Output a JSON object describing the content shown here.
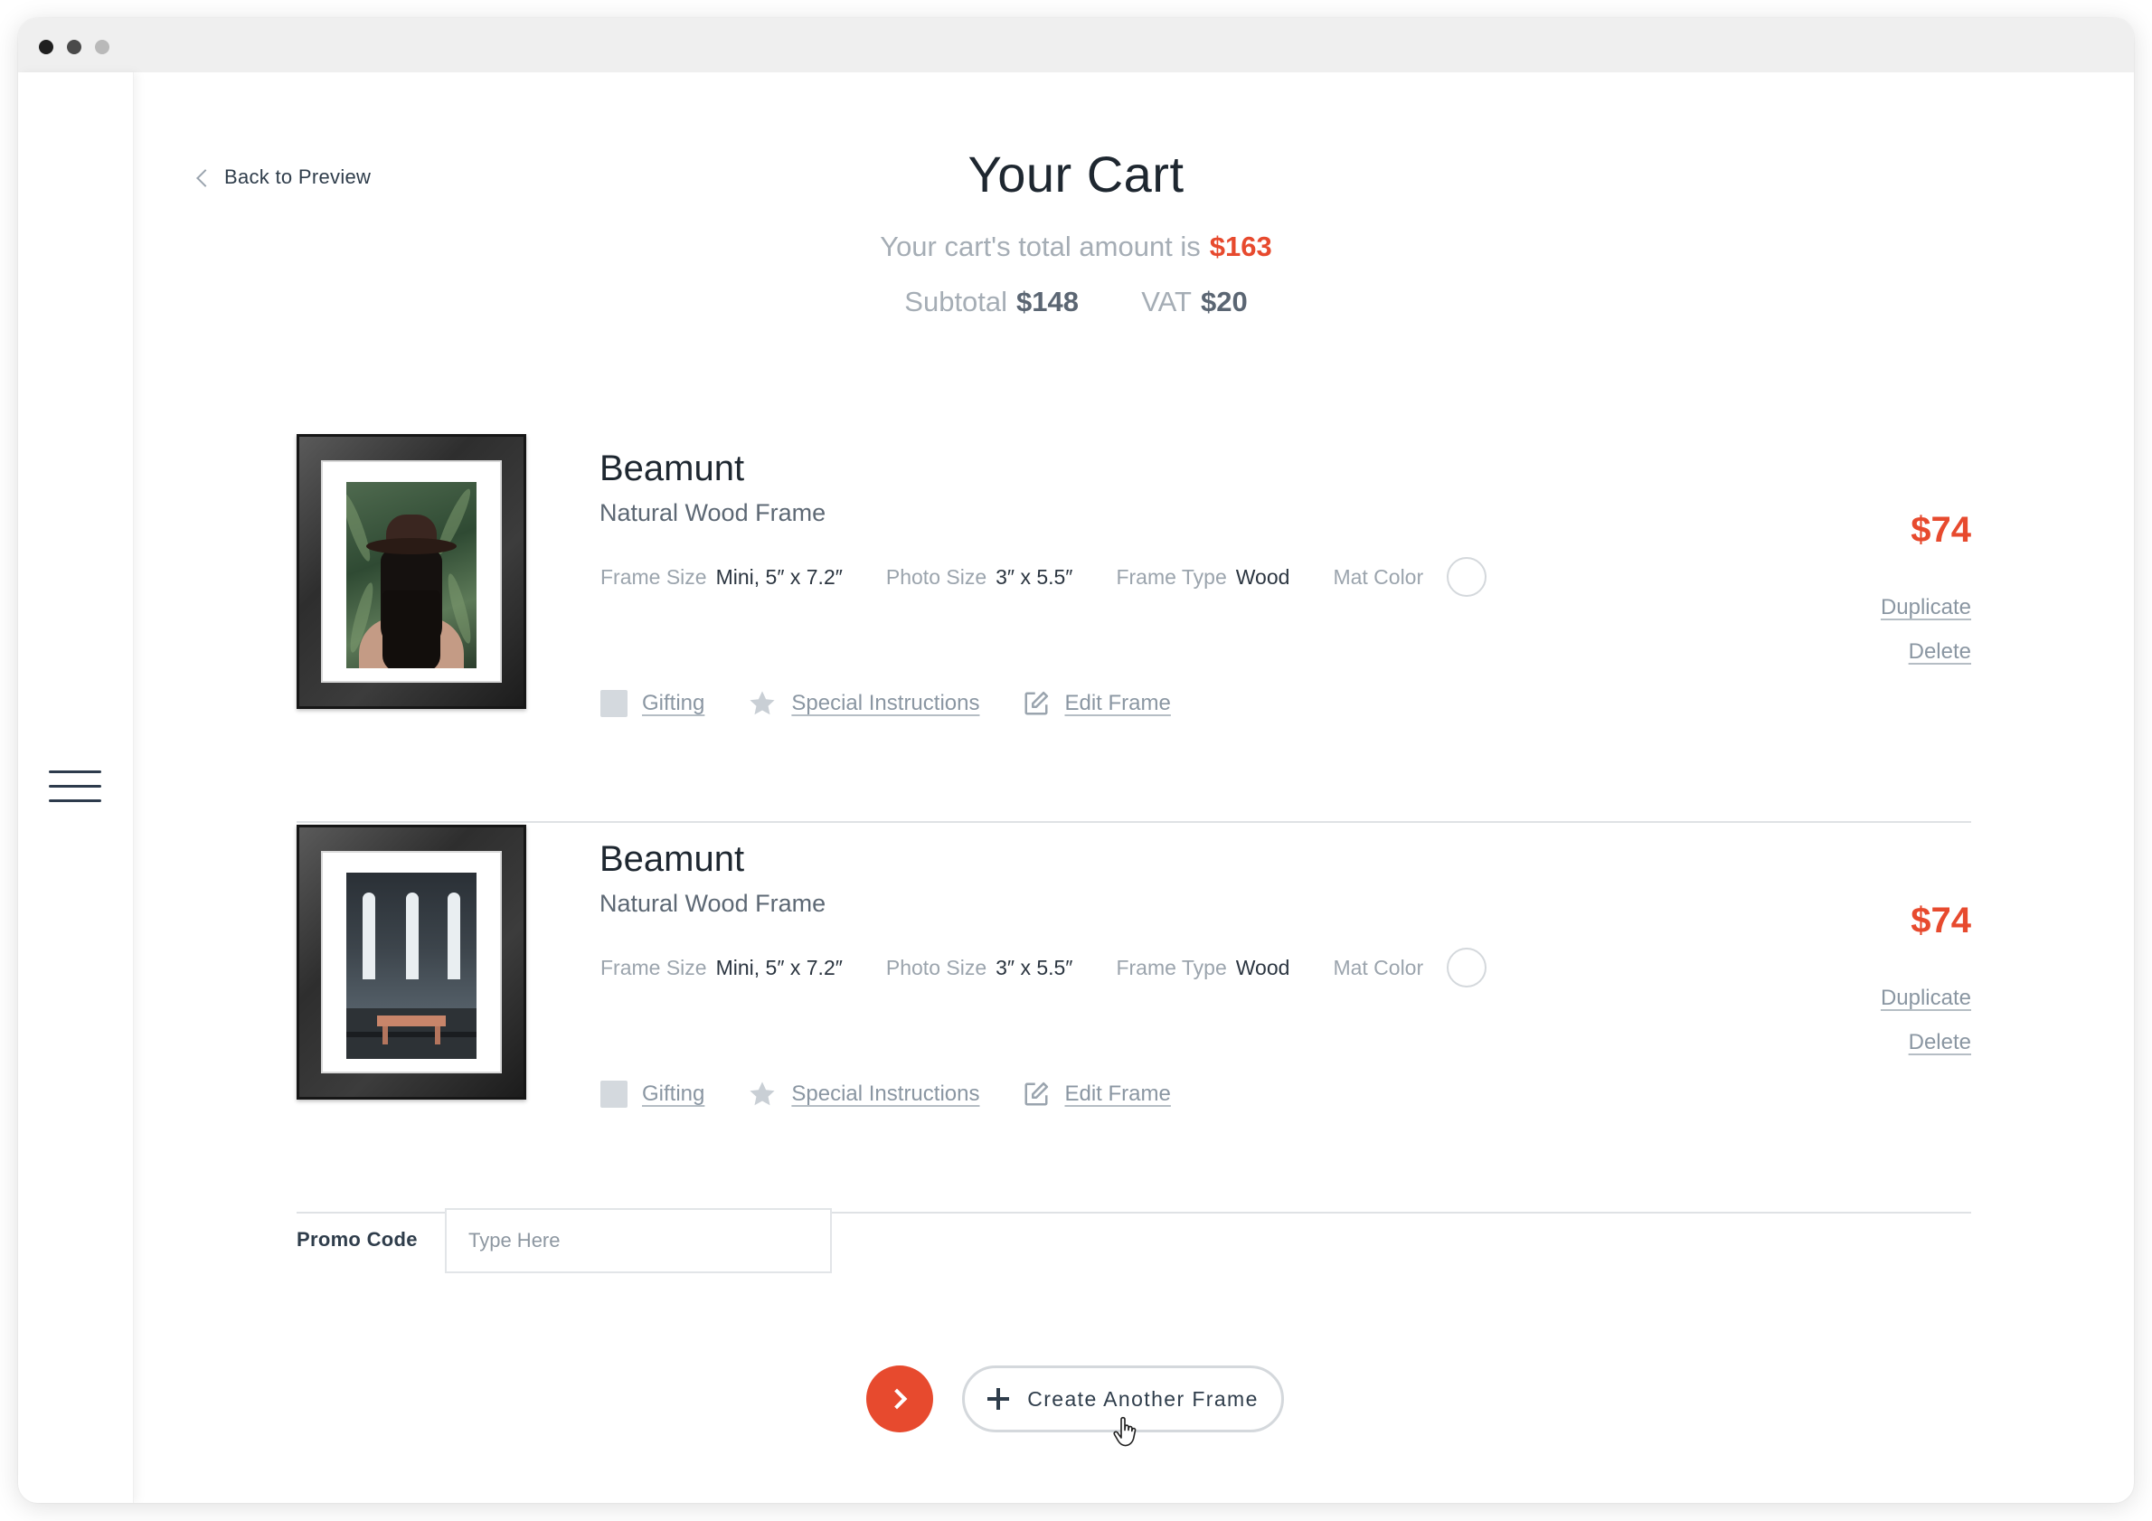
{
  "page": {
    "back_label": "Back to Preview",
    "title": "Your Cart",
    "total_text": "Your cart's total amount is",
    "total_amount": "$163",
    "subtotal_label": "Subtotal",
    "subtotal_value": "$148",
    "vat_label": "VAT",
    "vat_value": "$20"
  },
  "items": [
    {
      "name": "Beamunt",
      "subtitle": "Natural Wood Frame",
      "specs": {
        "frame_size_label": "Frame Size",
        "frame_size_value": "Mini, 5″ x 7.2″",
        "photo_size_label": "Photo Size",
        "photo_size_value": "3″ x 5.5″",
        "frame_type_label": "Frame Type",
        "frame_type_value": "Wood",
        "mat_color_label": "Mat Color"
      },
      "actions": {
        "gifting": "Gifting",
        "special_instructions": "Special Instructions",
        "edit_frame": "Edit Frame"
      },
      "price": "$74",
      "duplicate": "Duplicate",
      "delete": "Delete",
      "photo_icon": "woman-in-hat-photo"
    },
    {
      "name": "Beamunt",
      "subtitle": "Natural Wood Frame",
      "specs": {
        "frame_size_label": "Frame Size",
        "frame_size_value": "Mini, 5″ x 7.2″",
        "photo_size_label": "Photo Size",
        "photo_size_value": "3″ x 5.5″",
        "frame_type_label": "Frame Type",
        "frame_type_value": "Wood",
        "mat_color_label": "Mat Color"
      },
      "actions": {
        "gifting": "Gifting",
        "special_instructions": "Special Instructions",
        "edit_frame": "Edit Frame"
      },
      "price": "$74",
      "duplicate": "Duplicate",
      "delete": "Delete",
      "photo_icon": "chapel-interior-photo"
    }
  ],
  "promo": {
    "label": "Promo Code",
    "placeholder": "Type Here",
    "value": ""
  },
  "footer": {
    "create_label": "Create Another Frame"
  },
  "colors": {
    "accent": "#e74a2e",
    "text_dark": "#1e2730",
    "muted": "#a5adb5",
    "link": "#8a96a2"
  },
  "icons": [
    "menu-icon",
    "chevron-left-icon",
    "checkbox-icon",
    "star-icon",
    "edit-icon",
    "chevron-right-icon",
    "plus-icon",
    "hand-cursor-icon"
  ]
}
